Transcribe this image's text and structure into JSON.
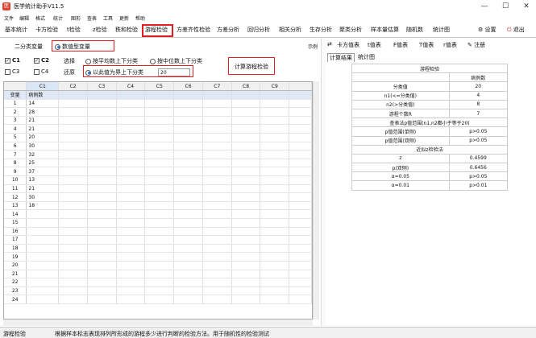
{
  "window": {
    "title": "医学统计助手V11.5",
    "controls": [
      "—",
      "☐",
      "✕"
    ]
  },
  "menu": [
    "文件",
    "编辑",
    "格式",
    "统计",
    "图形",
    "查表",
    "工具",
    "更新",
    "帮助"
  ],
  "tabs": [
    "基本统计",
    "卡方检验",
    "t检验",
    "z检验",
    "秩和检验",
    "游程检验",
    "方差齐性检验",
    "方差分析",
    "回归分析",
    "相关分析",
    "生存分析",
    "聚类分析",
    "样本量估算",
    "随机数",
    "统计图"
  ],
  "active_tab": "游程检验",
  "toolbar_right": {
    "settings": "设置",
    "exit": "退出"
  },
  "left": {
    "var_type_label": "二分类变量",
    "numeric_label": "数值型变量",
    "example": "示例",
    "checks": [
      {
        "label": "C1",
        "checked": true
      },
      {
        "label": "C2",
        "checked": true
      },
      {
        "label": "C3",
        "checked": false
      },
      {
        "label": "C4",
        "checked": false
      }
    ],
    "select_label": "选择",
    "restore_label": "还原",
    "opt_mean": "按平均数上下分类",
    "opt_median": "按中位数上下分类",
    "opt_value": "以此值为界上下分类",
    "threshold": "20",
    "run_button": "计算游程检验"
  },
  "grid": {
    "columns": [
      "C1",
      "C2",
      "C3",
      "C4",
      "C5",
      "C6",
      "C7",
      "C8",
      "C9"
    ],
    "var_label": "变量",
    "var_name": "病例数",
    "rows": [
      "1",
      "2",
      "3",
      "4",
      "5",
      "6",
      "7",
      "8",
      "9",
      "10",
      "11",
      "12",
      "13",
      "14",
      "15",
      "16",
      "17",
      "18",
      "19",
      "20",
      "21",
      "22",
      "23",
      "24"
    ],
    "values": [
      "14",
      "28",
      "21",
      "21",
      "20",
      "30",
      "32",
      "25",
      "37",
      "13",
      "21",
      "30",
      "18"
    ]
  },
  "right": {
    "tool_tabs": [
      "卡方值表",
      "t值表",
      "F值表",
      "T值表",
      "r值表",
      "注册"
    ],
    "result_tabs": [
      "计算结果",
      "统计图"
    ],
    "title": "游程检验",
    "col_header": "病例数",
    "rows": [
      [
        "分类值",
        "20"
      ],
      [
        "n1(<=分类值)",
        "4"
      ],
      [
        "n2(>分类值)",
        "8"
      ],
      [
        "游程个数R",
        "7"
      ],
      [
        "查表法p值范围(n1,n2都小于等于20)",
        ""
      ],
      [
        "p值范围(单侧)",
        "p>0.05"
      ],
      [
        "p值范围(双侧)",
        "p>0.05"
      ],
      [
        "近似z检验法",
        ""
      ],
      [
        "z",
        "0.4599"
      ],
      [
        "p(双侧)",
        "0.6456"
      ],
      [
        "α=0.05",
        "p>0.05"
      ],
      [
        "α=0.01",
        "p>0.01"
      ]
    ]
  },
  "status": {
    "left": "游程检验",
    "text": "根据样本标志表现排列所形成的游程多少进行判断的检验方法。用于随机性的检验测试"
  }
}
